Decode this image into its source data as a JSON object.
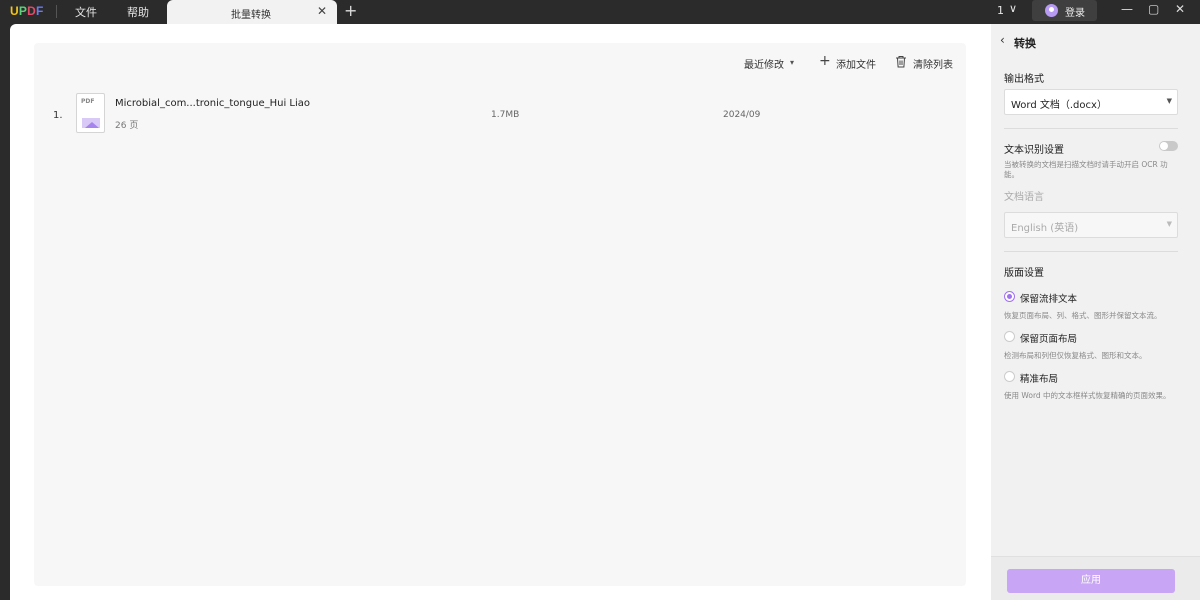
{
  "titlebar": {
    "logo": {
      "u": "U",
      "p": "P",
      "d": "D",
      "f": "F"
    },
    "menu": [
      "文件",
      "帮助"
    ],
    "tab_label": "批量转换",
    "tab_close": "✕",
    "tab_add": "+",
    "page_count": "1",
    "page_chevron": "∨",
    "login_label": "登录",
    "window_buttons": [
      "—",
      "▢",
      "✕"
    ]
  },
  "toolbar": {
    "sort_label": "最近修改",
    "sort_arrow": "▾",
    "add_icon": "+",
    "add_label": "添加文件",
    "clear_label": "清除列表"
  },
  "files": [
    {
      "index": "1.",
      "icon_text": "PDF",
      "name": "Microbial_com...tronic_tongue_Hui Liao",
      "pages": "26 页",
      "size": "1.7MB",
      "date": "2024/09"
    }
  ],
  "side": {
    "back_icon": "‹",
    "title": "转换",
    "output_format_label": "输出格式",
    "output_format_value": "Word 文档（.docx）",
    "ocr_label": "文本识别设置",
    "ocr_enabled": false,
    "ocr_hint": "当被转换的文档是扫描文档时请手动开启 OCR 功能。",
    "doc_language_label": "文档语言",
    "doc_language_value": "English (英语)",
    "layout_label": "版面设置",
    "layout_options": [
      {
        "label": "保留流排文本",
        "desc": "恢复页面布局、列、格式、图形并保留文本流。",
        "checked": true
      },
      {
        "label": "保留页面布局",
        "desc": "检测布局和列但仅恢复格式、图形和文本。",
        "checked": false
      },
      {
        "label": "精准布局",
        "desc": "使用 Word 中的文本框样式恢复精确的页面效果。",
        "checked": false
      }
    ],
    "apply_label": "应用"
  },
  "colors": {
    "accent": "#a072f0",
    "apply_button": "#c9a6f5",
    "titlebar_bg": "#2b2b2b"
  }
}
